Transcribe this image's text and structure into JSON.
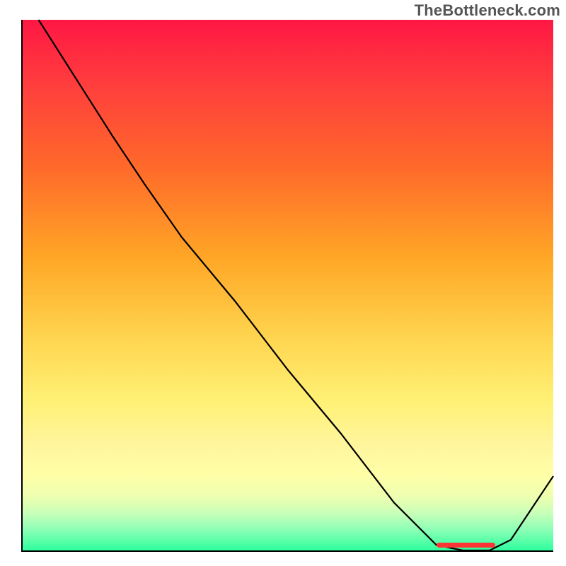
{
  "watermark": "TheBottleneck.com",
  "colors": {
    "line": "#000000",
    "marker": "#ff3535",
    "axis": "#000000"
  },
  "chart_data": {
    "type": "line",
    "title": "",
    "xlabel": "",
    "ylabel": "",
    "xlim": [
      0,
      100
    ],
    "ylim": [
      0,
      100
    ],
    "grid": false,
    "legend": false,
    "series": [
      {
        "name": "curve",
        "x": [
          3,
          10,
          17,
          23,
          30,
          40,
          50,
          60,
          70,
          78,
          83,
          88,
          92,
          100
        ],
        "y": [
          100,
          89,
          78,
          69,
          59,
          47,
          34,
          22,
          9,
          1,
          0,
          0,
          2,
          14
        ]
      }
    ],
    "marker": {
      "x_start": 78,
      "x_end": 89,
      "y": 0.5
    }
  }
}
